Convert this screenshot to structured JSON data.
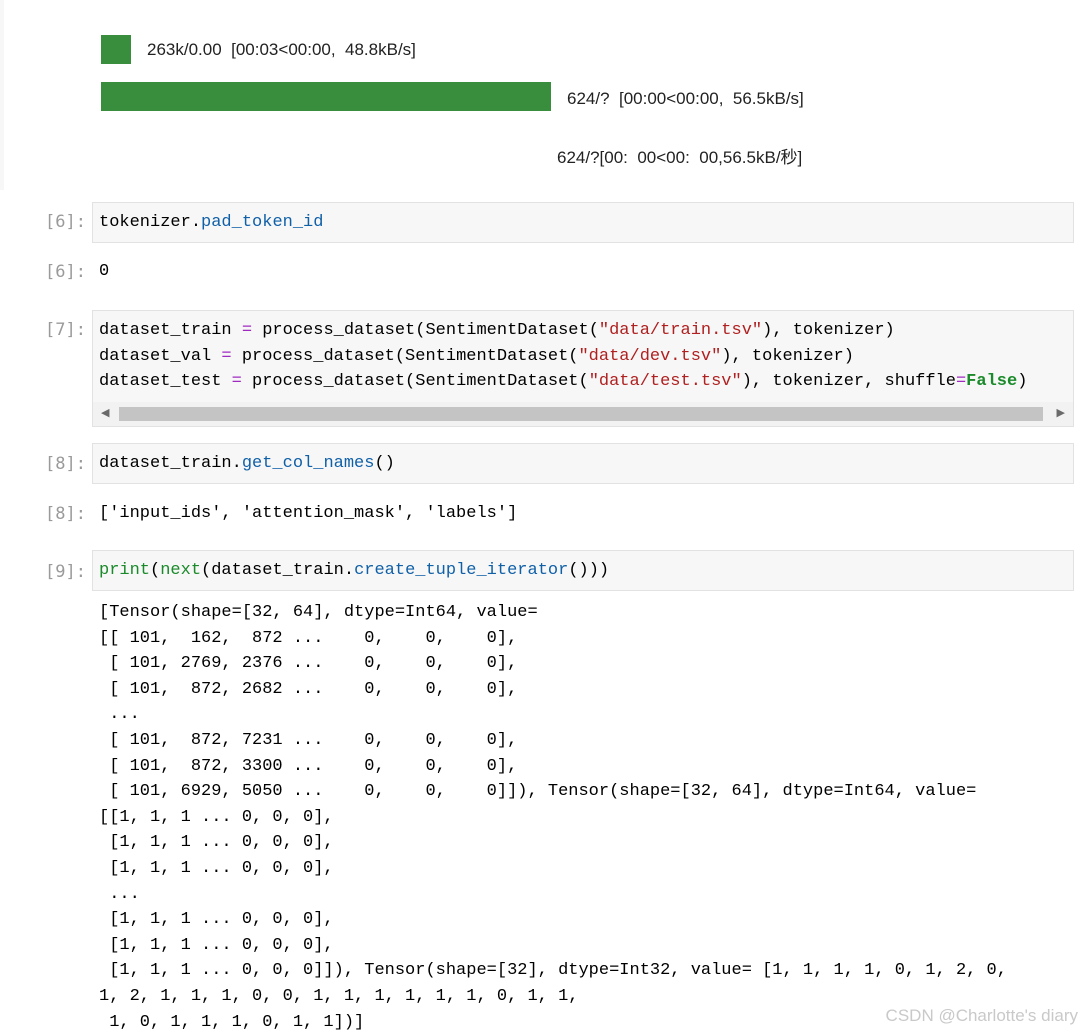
{
  "progress": {
    "bar1": {
      "text": "263k/0.00  [00:03<00:00,  48.8kB/s]",
      "color": "#388e3c"
    },
    "bar2": {
      "text": "624/?  [00:00<00:00,  56.5kB/s]",
      "color": "#388e3c"
    },
    "translated_text": "624/?[00:  00<00:  00,56.5kB/秒]"
  },
  "cells": [
    {
      "prompt_in": "[6]:",
      "code": [
        "tokenizer.",
        "pad_token_id"
      ],
      "prompt_out": "[6]:",
      "output": "0"
    },
    {
      "prompt_in": "[7]:",
      "lines": [
        {
          "var": "dataset_train",
          "eq": "=",
          "call": "process_dataset(SentimentDataset(",
          "str": "\"data/train.tsv\"",
          "rest": "), tokenizer)"
        },
        {
          "var": "dataset_val",
          "eq": "=",
          "call": "process_dataset(SentimentDataset(",
          "str": "\"data/dev.tsv\"",
          "rest": "), tokenizer)"
        },
        {
          "var": "dataset_test",
          "eq": "=",
          "call": "process_dataset(SentimentDataset(",
          "str": "\"data/test.tsv\"",
          "rest": "), tokenizer, shuffle",
          "eq2": "=",
          "bool": "False",
          "tail": ")"
        }
      ],
      "scrollbar": {
        "left_arrow": "◀",
        "right_arrow": "▶"
      }
    },
    {
      "prompt_in": "[8]:",
      "code": [
        "dataset_train.",
        "get_col_names",
        "()"
      ],
      "prompt_out": "[8]:",
      "output": "['input_ids', 'attention_mask', 'labels']"
    },
    {
      "prompt_in": "[9]:",
      "code": [
        "print",
        "(",
        "next",
        "(dataset_train.",
        "create_tuple_iterator",
        "()))"
      ],
      "output": "[Tensor(shape=[32, 64], dtype=Int64, value=\n[[ 101,  162,  872 ...    0,    0,    0],\n [ 101, 2769, 2376 ...    0,    0,    0],\n [ 101,  872, 2682 ...    0,    0,    0],\n ...\n [ 101,  872, 7231 ...    0,    0,    0],\n [ 101,  872, 3300 ...    0,    0,    0],\n [ 101, 6929, 5050 ...    0,    0,    0]]), Tensor(shape=[32, 64], dtype=Int64, value=\n[[1, 1, 1 ... 0, 0, 0],\n [1, 1, 1 ... 0, 0, 0],\n [1, 1, 1 ... 0, 0, 0],\n ...\n [1, 1, 1 ... 0, 0, 0],\n [1, 1, 1 ... 0, 0, 0],\n [1, 1, 1 ... 0, 0, 0]]), Tensor(shape=[32], dtype=Int32, value= [1, 1, 1, 1, 0, 1, 2, 0,\n1, 2, 1, 1, 1, 0, 0, 1, 1, 1, 1, 1, 1, 0, 1, 1,\n 1, 0, 1, 1, 1, 0, 1, 1])]"
    }
  ],
  "watermark": "CSDN @Charlotte's diary"
}
